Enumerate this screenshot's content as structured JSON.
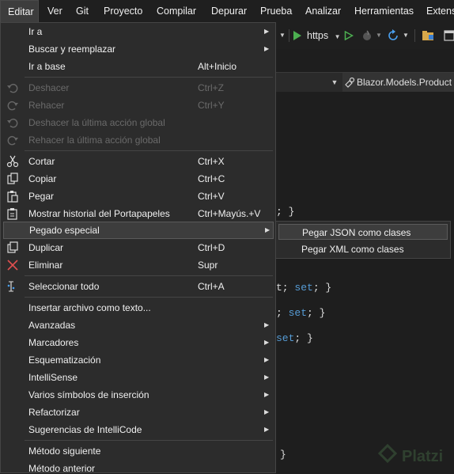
{
  "menubar": {
    "items": [
      {
        "label": "Editar",
        "active": true
      },
      {
        "label": "Ver"
      },
      {
        "label": "Git"
      },
      {
        "label": "Proyecto"
      },
      {
        "label": "Compilar"
      },
      {
        "label": "Depurar"
      },
      {
        "label": "Prueba"
      },
      {
        "label": "Analizar"
      },
      {
        "label": "Herramientas"
      },
      {
        "label": "Extensi"
      }
    ]
  },
  "toolbar": {
    "run_target": "https",
    "icons": [
      "play-icon",
      "play-outline-icon",
      "hot-reload-icon",
      "refresh-icon",
      "folder-icon"
    ]
  },
  "navbar": {
    "member": "Blazor.Models.Product"
  },
  "code": {
    "line1": "; }",
    "line2a": "t; ",
    "line2b": "set",
    "line2c": "; }",
    "line3a": "; ",
    "line3b": "set",
    "line3c": "; }",
    "line4a": "set",
    "line4b": "; }",
    "line5": "}"
  },
  "menu": {
    "items": [
      {
        "label": "Ir a",
        "shortcut": "",
        "arrow": "▶"
      },
      {
        "label": "Buscar y reemplazar",
        "shortcut": "",
        "arrow": "▶"
      },
      {
        "label": "Ir a base",
        "shortcut": "Alt+Inicio"
      },
      {
        "label": "Deshacer",
        "shortcut": "Ctrl+Z",
        "disabled": true,
        "icon": "undo-icon"
      },
      {
        "label": "Rehacer",
        "shortcut": "Ctrl+Y",
        "disabled": true,
        "icon": "redo-icon"
      },
      {
        "label": "Deshacer la última acción global",
        "shortcut": "",
        "disabled": true,
        "icon": "undo-global-icon"
      },
      {
        "label": "Rehacer la última acción global",
        "shortcut": "",
        "disabled": true,
        "icon": "redo-global-icon"
      },
      {
        "label": "Cortar",
        "shortcut": "Ctrl+X",
        "icon": "scissors-icon"
      },
      {
        "label": "Copiar",
        "shortcut": "Ctrl+C",
        "icon": "copy-icon"
      },
      {
        "label": "Pegar",
        "shortcut": "Ctrl+V",
        "icon": "paste-icon"
      },
      {
        "label": "Mostrar historial del Portapapeles",
        "shortcut": "Ctrl+Mayús.+V",
        "icon": "clipboard-history-icon"
      },
      {
        "label": "Pegado especial",
        "shortcut": "",
        "arrow": "▶"
      },
      {
        "label": "Duplicar",
        "shortcut": "Ctrl+D",
        "icon": "duplicate-icon"
      },
      {
        "label": "Eliminar",
        "shortcut": "Supr",
        "icon": "delete-x-icon"
      },
      {
        "label": "Seleccionar todo",
        "shortcut": "Ctrl+A",
        "icon": "select-all-icon"
      },
      {
        "label": "Insertar archivo como texto...",
        "shortcut": ""
      },
      {
        "label": "Avanzadas",
        "arrow": "▶"
      },
      {
        "label": "Marcadores",
        "arrow": "▶"
      },
      {
        "label": "Esquematización",
        "arrow": "▶"
      },
      {
        "label": "IntelliSense",
        "arrow": "▶"
      },
      {
        "label": "Varios símbolos de inserción",
        "arrow": "▶"
      },
      {
        "label": "Refactorizar",
        "arrow": "▶"
      },
      {
        "label": "Sugerencias de IntelliCode",
        "arrow": "▶"
      },
      {
        "label": "Método siguiente"
      },
      {
        "label": "Método anterior"
      }
    ]
  },
  "submenu": {
    "items": [
      {
        "label": "Pegar JSON como clases"
      },
      {
        "label": "Pegar XML como clases"
      }
    ]
  },
  "colors": {
    "background": "#1e1e1e",
    "menu": "#2c2c2c",
    "highlight": "#3d3d3d",
    "keyword": "#569cd6",
    "play_green": "#4caf50",
    "delete_red": "#e05050",
    "refresh_blue": "#4aa0f0"
  }
}
